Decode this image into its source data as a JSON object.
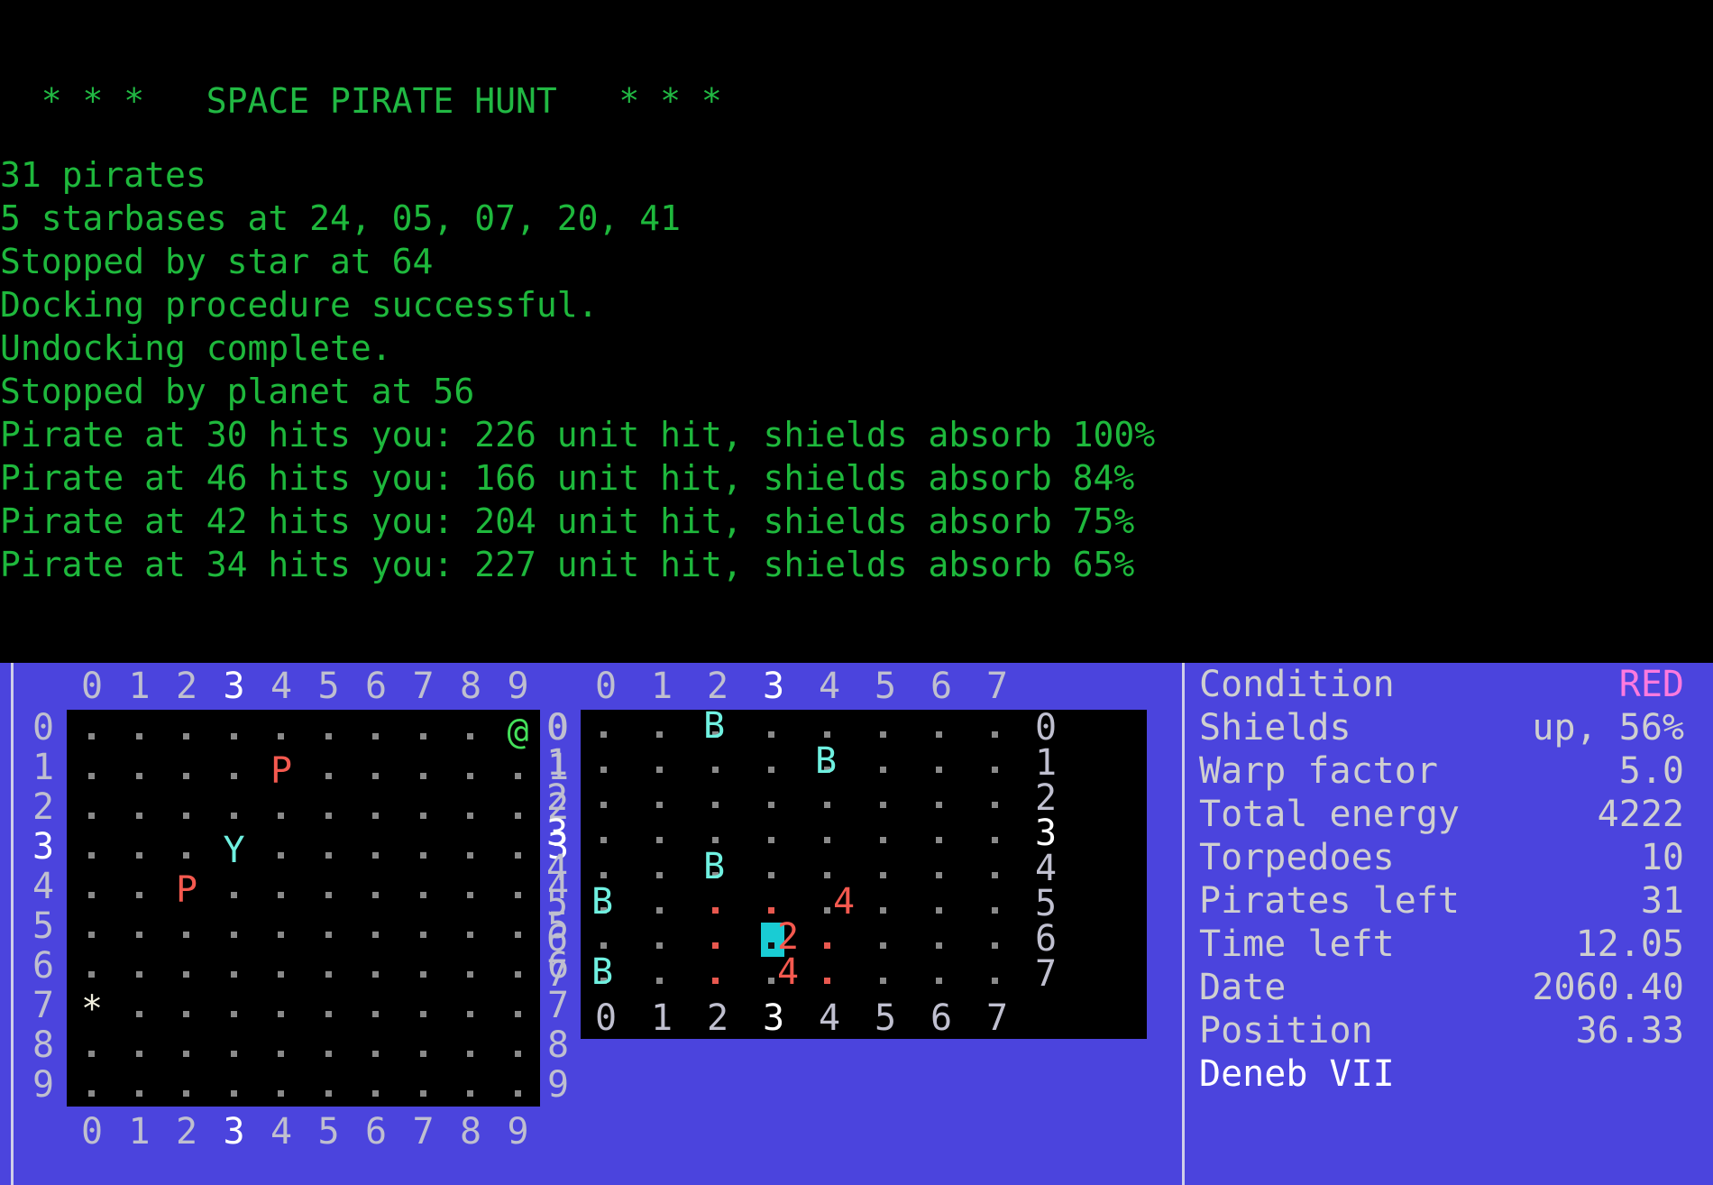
{
  "console": {
    "title": "  * * *   SPACE PIRATE HUNT   * * *",
    "lines": [
      "31 pirates",
      "5 starbases at 24, 05, 07, 20, 41",
      "Stopped by star at 64",
      "Docking procedure successful.",
      "Undocking complete.",
      "Stopped by planet at 56",
      "Pirate at 30 hits you: 226 unit hit, shields absorb 100%",
      "Pirate at 46 hits you: 166 unit hit, shields absorb 84%",
      "Pirate at 42 hits you: 204 unit hit, shields absorb 75%",
      "Pirate at 34 hits you: 227 unit hit, shields absorb 65%"
    ],
    "text_color": "#21b843"
  },
  "galaxy_map": {
    "name": "galaxy-quadrant-map",
    "col_headers_top": [
      "0",
      "1",
      "2",
      "3",
      "4",
      "5",
      "6",
      "7",
      "8",
      "9"
    ],
    "col_headers_bottom": [
      "0",
      "1",
      "2",
      "3",
      "4",
      "5",
      "6",
      "7",
      "8",
      "9"
    ],
    "row_headers_left": [
      "0",
      "1",
      "2",
      "3",
      "4",
      "5",
      "6",
      "7",
      "8",
      "9"
    ],
    "row_headers_right": [
      "0",
      "1",
      "2",
      "3",
      "4",
      "5",
      "6",
      "7",
      "8",
      "9"
    ],
    "highlight_col": "3",
    "highlight_row": "3",
    "markers": [
      {
        "row": 0,
        "col": 9,
        "glyph": "@",
        "color": "green",
        "name": "player-ship-marker"
      },
      {
        "row": 1,
        "col": 4,
        "glyph": "P",
        "color": "red",
        "name": "pirate-marker"
      },
      {
        "row": 3,
        "col": 3,
        "glyph": "Y",
        "color": "cyan",
        "name": "starbase-marker"
      },
      {
        "row": 4,
        "col": 2,
        "glyph": "P",
        "color": "red",
        "name": "pirate-marker"
      },
      {
        "row": 7,
        "col": 0,
        "glyph": "*",
        "color": "white",
        "name": "star-marker"
      }
    ]
  },
  "sector_map": {
    "name": "sector-scan-map",
    "col_headers_top": [
      "0",
      "1",
      "2",
      "3",
      "4",
      "5",
      "6",
      "7"
    ],
    "col_headers_bottom": [
      "0",
      "1",
      "2",
      "3",
      "4",
      "5",
      "6",
      "7"
    ],
    "row_headers_left": [
      "0",
      "1",
      "2",
      "3",
      "4",
      "5",
      "6",
      "7"
    ],
    "row_headers_right": [
      "0",
      "1",
      "2",
      "3",
      "4",
      "5",
      "6",
      "7"
    ],
    "highlight_col": "3",
    "highlight_row": "3",
    "markers": [
      {
        "row": 0,
        "col": 2,
        "glyph": "B",
        "color": "cyan",
        "name": "starbase-marker"
      },
      {
        "row": 1,
        "col": 4,
        "glyph": "B",
        "color": "cyan",
        "name": "starbase-marker"
      },
      {
        "row": 4,
        "col": 2,
        "glyph": "B",
        "color": "cyan",
        "name": "starbase-marker"
      },
      {
        "row": 5,
        "col": 0,
        "glyph": "B",
        "color": "cyan",
        "name": "starbase-marker"
      },
      {
        "row": 7,
        "col": 0,
        "glyph": "B",
        "color": "cyan",
        "name": "starbase-marker"
      },
      {
        "row": 5,
        "col": 4,
        "glyph": "4",
        "color": "red",
        "name": "pirate-count-marker"
      },
      {
        "row": 6,
        "col": 3,
        "glyph": "2",
        "color": "red",
        "name": "pirate-count-marker"
      },
      {
        "row": 7,
        "col": 3,
        "glyph": "4",
        "color": "red",
        "name": "pirate-count-marker"
      }
    ],
    "red_dots": [
      {
        "row": 5,
        "col": 2
      },
      {
        "row": 5,
        "col": 3
      },
      {
        "row": 6,
        "col": 2
      },
      {
        "row": 6,
        "col": 4
      },
      {
        "row": 7,
        "col": 2
      },
      {
        "row": 7,
        "col": 4
      }
    ],
    "cursor": {
      "row": 6,
      "col": 3,
      "color": "#19ccd4"
    }
  },
  "status": {
    "name": "ship-status-panel",
    "rows": [
      {
        "label": "Condition",
        "value": "RED",
        "alert": true
      },
      {
        "label": "Shields",
        "value": "up, 56%",
        "alert": false
      },
      {
        "label": "Warp factor",
        "value": "5.0",
        "alert": false
      },
      {
        "label": "Total energy",
        "value": "4222",
        "alert": false
      },
      {
        "label": "Torpedoes",
        "value": "10",
        "alert": false
      },
      {
        "label": "Pirates left",
        "value": "31",
        "alert": false
      },
      {
        "label": "Time left",
        "value": "12.05",
        "alert": false
      },
      {
        "label": "Date",
        "value": "2060.40",
        "alert": false
      },
      {
        "label": "Position",
        "value": "36.33",
        "alert": false
      }
    ],
    "planet": "Deneb VII"
  },
  "colors": {
    "panel_bg": "#4b44dd",
    "console_green": "#21b843",
    "condition_alert": "#ff7adf",
    "cursor_cyan": "#19ccd4",
    "marker_red": "#f4594f",
    "marker_cyan": "#6ff0e0",
    "marker_green": "#44e05a"
  }
}
